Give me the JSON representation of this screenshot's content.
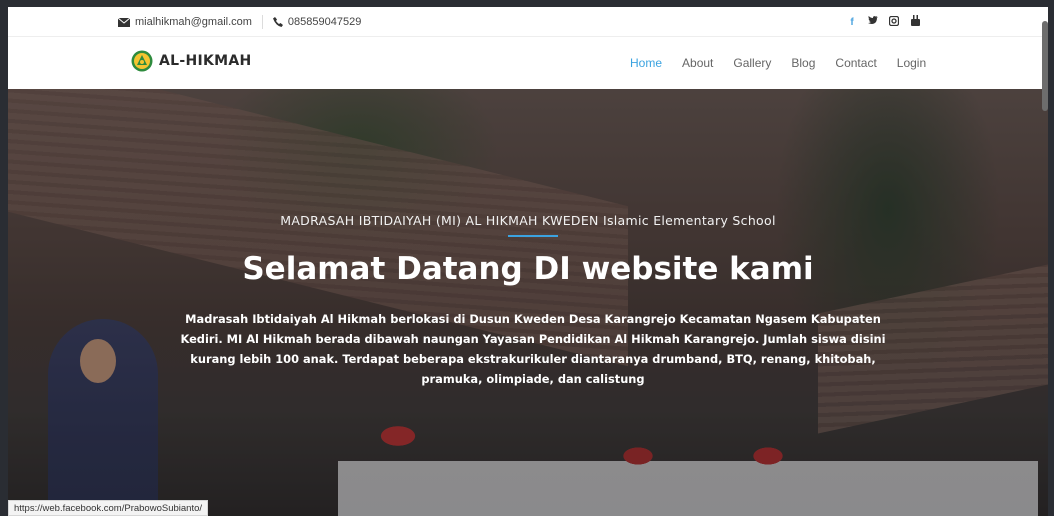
{
  "topbar": {
    "email": "mialhikmah@gmail.com",
    "phone": "085859047529",
    "social": [
      {
        "icon": "facebook-icon",
        "glyph": "f"
      },
      {
        "icon": "twitter-icon",
        "glyph": "♥"
      },
      {
        "icon": "instagram-icon",
        "glyph": "▣"
      },
      {
        "icon": "youtube-icon",
        "glyph": "▶"
      }
    ]
  },
  "nav": {
    "brand": "AL-HIKMAH",
    "items": [
      {
        "label": "Home",
        "active": true
      },
      {
        "label": "About",
        "active": false
      },
      {
        "label": "Gallery",
        "active": false
      },
      {
        "label": "Blog",
        "active": false
      },
      {
        "label": "Contact",
        "active": false
      },
      {
        "label": "Login",
        "active": false
      }
    ]
  },
  "hero": {
    "subtitle": "MADRASAH IBTIDAIYAH (MI) AL HIKMAH KWEDEN Islamic Elementary School",
    "title": "Selamat Datang DI website kami",
    "description": "Madrasah Ibtidaiyah Al Hikmah berlokasi di Dusun Kweden Desa Karangrejo Kecamatan Ngasem Kabupaten Kediri. MI Al Hikmah berada dibawah naungan Yayasan Pendidikan Al Hikmah Karangrejo. Jumlah siswa disini kurang lebih 100 anak. Terdapat beberapa ekstrakurikuler diantaranya drumband, BTQ, renang, khitobah, pramuka, olimpiade, dan calistung"
  },
  "status_url": "https://web.facebook.com/PrabowoSubianto/",
  "colors": {
    "accent": "#3ba3e0",
    "facebook": "#4aa3df"
  }
}
